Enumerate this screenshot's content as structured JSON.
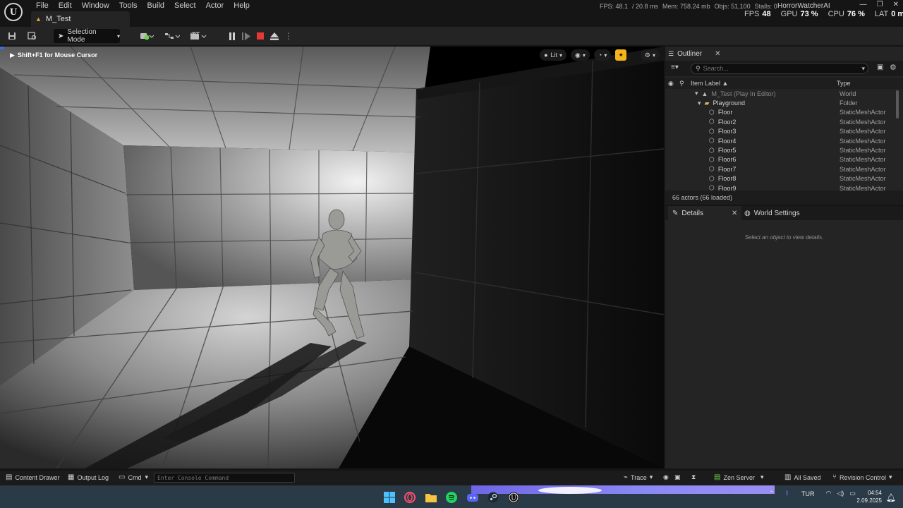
{
  "menu": {
    "logo": "U",
    "items": [
      "File",
      "Edit",
      "Window",
      "Tools",
      "Build",
      "Select",
      "Actor",
      "Help"
    ],
    "level_tab": "M_Test"
  },
  "perf": {
    "fps_text": "FPS: 48.1",
    "frame_ms": "/ 20.8 ms",
    "mem": "Mem: 758.24 mb",
    "objs": "Objs: 51,100",
    "stalls": "Stalls: 0",
    "project": "HorrorWatcherAI"
  },
  "stat_bar": {
    "fps_label": "FPS",
    "fps_value": "48",
    "gpu_label": "GPU",
    "gpu_value": "73 %",
    "cpu_label": "CPU",
    "cpu_value": "76 %",
    "lat_label": "LAT",
    "lat_value": "0 ms"
  },
  "toolbar": {
    "selection_mode": "Selection Mode"
  },
  "viewport": {
    "mouse_hint": "Shift+F1 for Mouse Cursor",
    "view_mode": "Lit"
  },
  "outliner": {
    "tab_label": "Outliner",
    "search_placeholder": "Search...",
    "col_item_label": "Item Label ▲",
    "col_type": "Type",
    "rows": [
      {
        "name": "M_Test (Play In Editor)",
        "type": "World",
        "indent": 42,
        "icon": "▾",
        "dim": true
      },
      {
        "name": "Playground",
        "type": "Folder",
        "indent": 50,
        "icon": "▾",
        "folder": true
      },
      {
        "name": "Floor",
        "type": "StaticMeshActor",
        "indent": 64
      },
      {
        "name": "Floor2",
        "type": "StaticMeshActor",
        "indent": 64
      },
      {
        "name": "Floor3",
        "type": "StaticMeshActor",
        "indent": 64
      },
      {
        "name": "Floor4",
        "type": "StaticMeshActor",
        "indent": 64
      },
      {
        "name": "Floor5",
        "type": "StaticMeshActor",
        "indent": 64
      },
      {
        "name": "Floor6",
        "type": "StaticMeshActor",
        "indent": 64
      },
      {
        "name": "Floor7",
        "type": "StaticMeshActor",
        "indent": 64
      },
      {
        "name": "Floor8",
        "type": "StaticMeshActor",
        "indent": 64
      },
      {
        "name": "Floor9",
        "type": "StaticMeshActor",
        "indent": 64
      }
    ],
    "footer": "66 actors (66 loaded)"
  },
  "details": {
    "tab_label": "Details",
    "world_settings_label": "World Settings",
    "empty_message": "Select an object to view details."
  },
  "statusbar": {
    "content_drawer": "Content Drawer",
    "output_log": "Output Log",
    "cmd": "Cmd",
    "console_placeholder": "Enter Console Command",
    "trace": "Trace",
    "zen_server": "Zen Server",
    "all_saved": "All Saved",
    "revision_control": "Revision Control"
  },
  "taskbar": {
    "language": "TUR",
    "time": "04:54",
    "date": "2.09.2025"
  },
  "colors": {
    "accent_yellow": "#f2b31b",
    "stop_red": "#e53935",
    "panel_bg": "#242424"
  }
}
